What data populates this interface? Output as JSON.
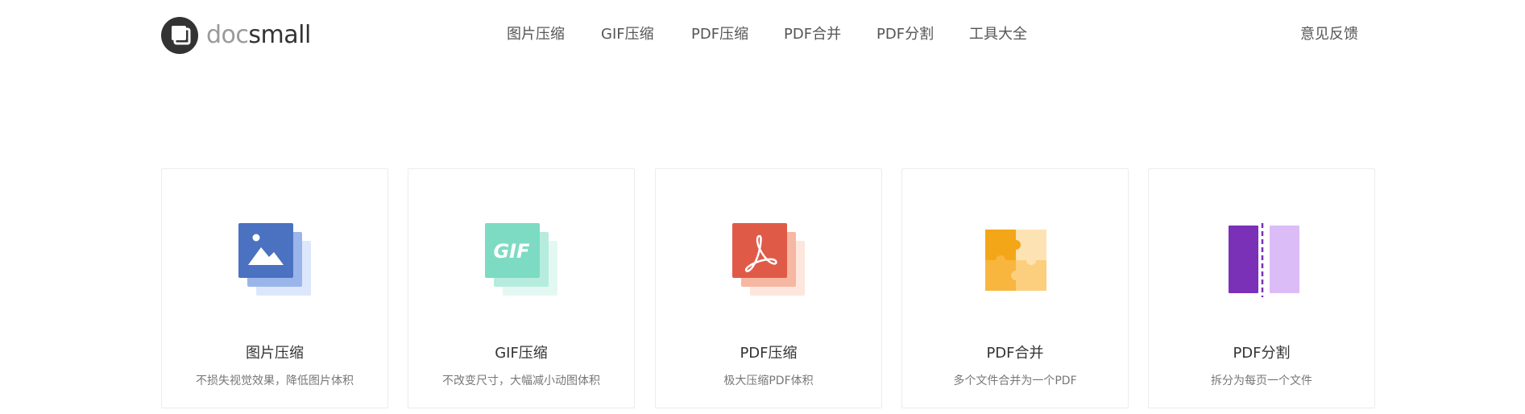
{
  "brand": {
    "prefix": "doc",
    "suffix": "small"
  },
  "nav": [
    {
      "label": "图片压缩"
    },
    {
      "label": "GIF压缩"
    },
    {
      "label": "PDF压缩"
    },
    {
      "label": "PDF合并"
    },
    {
      "label": "PDF分割"
    },
    {
      "label": "工具大全"
    }
  ],
  "feedback": {
    "label": "意见反馈"
  },
  "cards": [
    {
      "title": "图片压缩",
      "description": "不损失视觉效果，降低图片体积",
      "icon": "image-icon",
      "color": "#4a72c0"
    },
    {
      "title": "GIF压缩",
      "description": "不改变尺寸，大幅减小动图体积",
      "icon": "gif-icon",
      "color": "#7ddbc3",
      "icon_text": "GIF"
    },
    {
      "title": "PDF压缩",
      "description": "极大压缩PDF体积",
      "icon": "pdf-icon",
      "color": "#e05a48"
    },
    {
      "title": "PDF合并",
      "description": "多个文件合并为一个PDF",
      "icon": "puzzle-icon",
      "color": "#f4a619"
    },
    {
      "title": "PDF分割",
      "description": "拆分为每页一个文件",
      "icon": "split-icon",
      "color": "#7b30b8"
    }
  ]
}
